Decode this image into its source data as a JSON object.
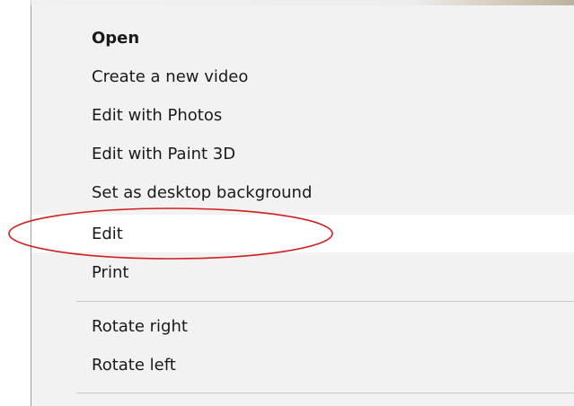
{
  "context_menu": {
    "items": [
      {
        "label": "Open"
      },
      {
        "label": "Create a new video"
      },
      {
        "label": "Edit with Photos"
      },
      {
        "label": "Edit with Paint 3D"
      },
      {
        "label": "Set as desktop background"
      },
      {
        "label": "Edit"
      },
      {
        "label": "Print"
      },
      {
        "label": "Rotate right"
      },
      {
        "label": "Rotate left"
      }
    ],
    "highlighted_item": "Edit"
  },
  "annotation": {
    "shape": "ellipse",
    "color": "#d21f1f",
    "target_item": "Edit"
  },
  "colors": {
    "menu_background": "#f2f2f2",
    "hover_background": "#ffffff",
    "separator": "#c8c8c8",
    "text": "#1a1a1a"
  }
}
